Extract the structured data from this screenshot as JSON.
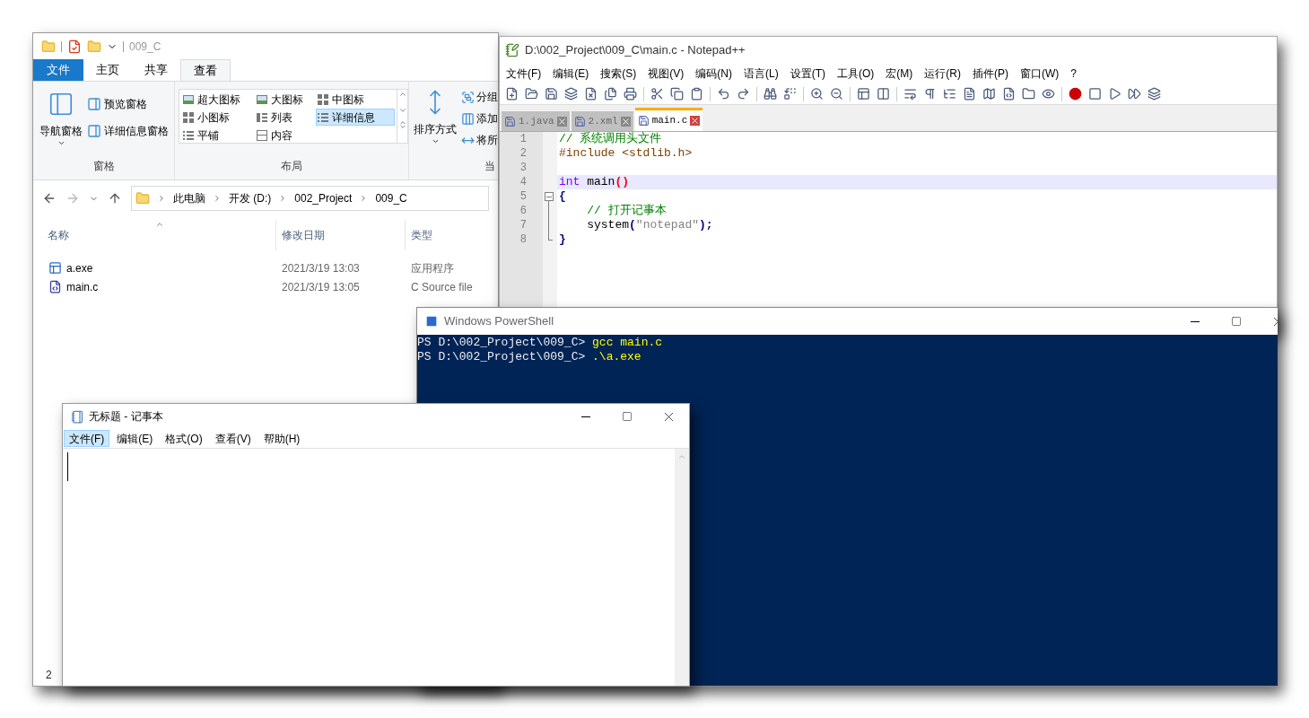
{
  "explorer": {
    "title": "009_C",
    "ribbon_tabs": [
      {
        "label": "文件",
        "kind": "file",
        "selected": false
      },
      {
        "label": "主页",
        "kind": "tab",
        "selected": false
      },
      {
        "label": "共享",
        "kind": "tab",
        "selected": false
      },
      {
        "label": "查看",
        "kind": "tab",
        "selected": true
      }
    ],
    "panes_group": {
      "nav_pane": "导航窗格",
      "items": [
        "预览窗格",
        "详细信息窗格"
      ],
      "label": "窗格"
    },
    "layout_group": {
      "options": [
        {
          "label": "超大图标",
          "selected": false
        },
        {
          "label": "大图标",
          "selected": false
        },
        {
          "label": "中图标",
          "selected": false
        },
        {
          "label": "小图标",
          "selected": false
        },
        {
          "label": "列表",
          "selected": false
        },
        {
          "label": "详细信息",
          "selected": true
        },
        {
          "label": "平铺",
          "selected": false
        },
        {
          "label": "内容",
          "selected": false
        }
      ],
      "label": "布局"
    },
    "sort_group": {
      "sort": "排序方式",
      "items": [
        "分组",
        "添加",
        "将所"
      ],
      "label": "当"
    },
    "breadcrumb": [
      "此电脑",
      "开发 (D:)",
      "002_Project",
      "009_C"
    ],
    "columns": [
      "名称",
      "修改日期",
      "类型"
    ],
    "files": [
      {
        "name": "a.exe",
        "kind": "exe",
        "date": "2021/3/19 13:03",
        "type": "应用程序"
      },
      {
        "name": "main.c",
        "kind": "c",
        "date": "2021/3/19 13:05",
        "type": "C Source file"
      }
    ],
    "status": "2"
  },
  "notepadpp": {
    "title": "D:\\002_Project\\009_C\\main.c - Notepad++",
    "menu": [
      "文件(F)",
      "编辑(E)",
      "搜索(S)",
      "视图(V)",
      "编码(N)",
      "语言(L)",
      "设置(T)",
      "工具(O)",
      "宏(M)",
      "运行(R)",
      "插件(P)",
      "窗口(W)",
      "?"
    ],
    "tabs": [
      {
        "label": "1.java",
        "selected": false
      },
      {
        "label": "2.xml",
        "selected": false
      },
      {
        "label": "main.c",
        "selected": true
      }
    ],
    "lines": [
      {
        "number": "1",
        "current": false,
        "tokens": [
          {
            "kind": "comment",
            "text": "// 系统调用头文件"
          }
        ]
      },
      {
        "number": "2",
        "current": false,
        "tokens": [
          {
            "kind": "preprocessor",
            "text": "#include <stdlib.h>"
          }
        ]
      },
      {
        "number": "3",
        "current": false
      },
      {
        "number": "4",
        "current": true,
        "tokens": [
          {
            "kind": "keyword",
            "text": "int"
          },
          {
            "kind": "plain",
            "text": " main"
          },
          {
            "kind": "brace_match",
            "text": "()"
          }
        ]
      },
      {
        "number": "5",
        "current": false,
        "expanded": true,
        "tokens": [
          {
            "kind": "operator",
            "text": "{"
          }
        ],
        "children": [
          {
            "number": "6",
            "current": false,
            "tokens": [
              {
                "kind": "comment",
                "text": "    // 打开记事本"
              }
            ]
          },
          {
            "number": "7",
            "current": false,
            "tokens": [
              {
                "kind": "plain",
                "text": "    system"
              },
              {
                "kind": "operator",
                "text": "("
              },
              {
                "kind": "string",
                "text": "\"notepad\""
              },
              {
                "kind": "operator",
                "text": ");"
              }
            ]
          },
          {
            "number": "8",
            "current": false,
            "tokens": [
              {
                "kind": "operator",
                "text": "}"
              }
            ]
          }
        ]
      }
    ]
  },
  "powershell": {
    "title": "Windows PowerShell",
    "lines": [
      {
        "prompt": "PS D:\\002_Project\\009_C> ",
        "command": "gcc main.c"
      },
      {
        "prompt": "PS D:\\002_Project\\009_C> ",
        "command": ".\\a.exe"
      }
    ]
  },
  "notepad": {
    "title": "无标题 - 记事本",
    "menu": [
      {
        "label": "文件(F)",
        "selected": true
      },
      {
        "label": "编辑(E)",
        "selected": false
      },
      {
        "label": "格式(O)",
        "selected": false
      },
      {
        "label": "查看(V)",
        "selected": false
      },
      {
        "label": "帮助(H)",
        "selected": false
      }
    ]
  }
}
